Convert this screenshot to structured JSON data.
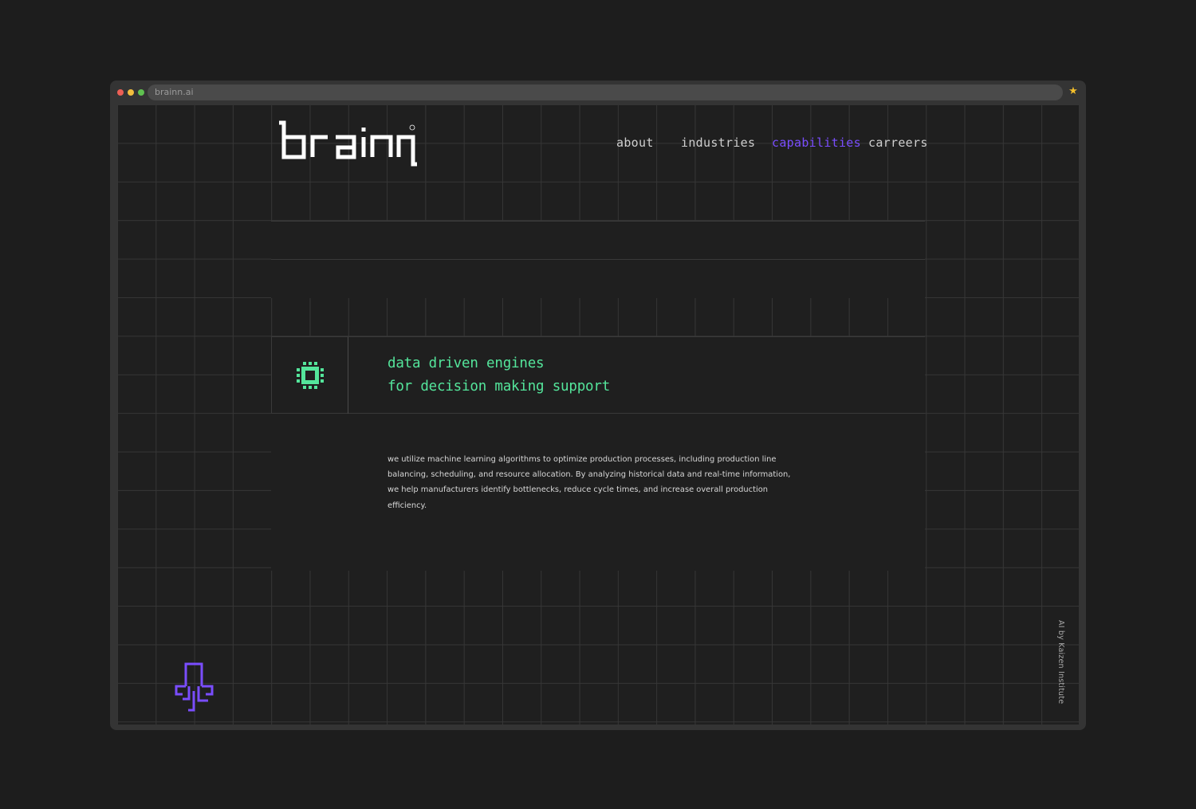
{
  "browser": {
    "url": "brainn.ai",
    "bookmark_icon": "star-icon"
  },
  "header": {
    "logo_text": "brainn",
    "logo_mark": "®"
  },
  "nav": {
    "items": [
      {
        "label": "about"
      },
      {
        "label": "industries"
      },
      {
        "label": "capabilities"
      },
      {
        "label": "carreers"
      }
    ],
    "active_index": 2
  },
  "capability": {
    "icon": "chip-icon",
    "headline_line1": "data driven engines",
    "headline_line2": "for decision making support",
    "description": "we utilize machine learning algorithms to optimize production processes, including production line balancing, scheduling, and resource allocation. By analyzing historical data and real-time information, we help manufacturers identify bottlenecks, reduce cycle times, and increase overall production efficiency."
  },
  "footer": {
    "mascot_icon": "octopus-icon",
    "credit": "AI by Kaizen Institute"
  },
  "colors": {
    "accent_green": "#54e59b",
    "accent_purple": "#7a4dff",
    "background": "#1f1f1f",
    "chrome": "#343434"
  }
}
